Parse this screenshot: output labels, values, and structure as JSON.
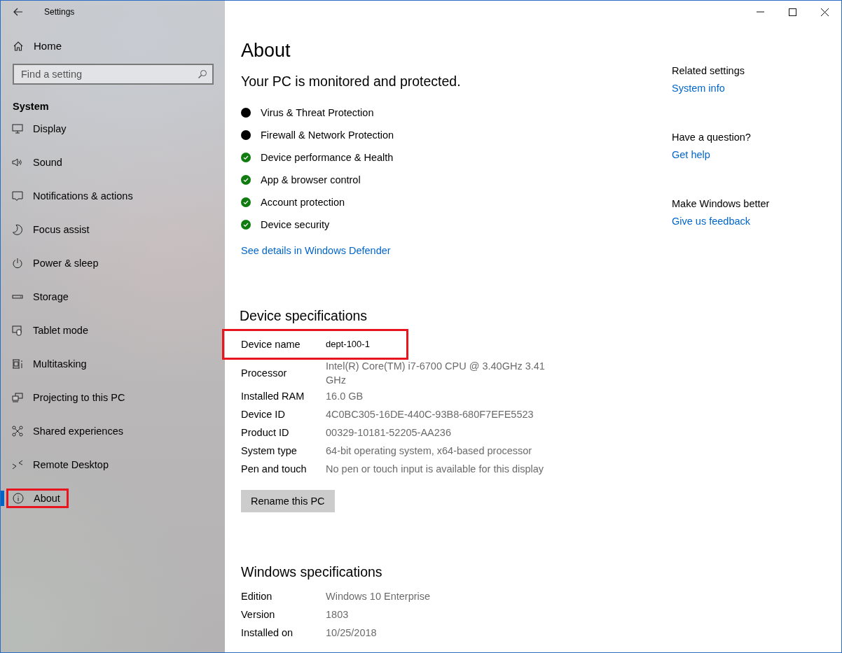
{
  "window": {
    "title": "Settings"
  },
  "sidebar": {
    "home": "Home",
    "search": {
      "placeholder": "Find a setting"
    },
    "section": "System",
    "items": [
      {
        "label": "Display",
        "selected": false,
        "highlighted": false
      },
      {
        "label": "Sound",
        "selected": false,
        "highlighted": false
      },
      {
        "label": "Notifications & actions",
        "selected": false,
        "highlighted": false
      },
      {
        "label": "Focus assist",
        "selected": false,
        "highlighted": false
      },
      {
        "label": "Power & sleep",
        "selected": false,
        "highlighted": false
      },
      {
        "label": "Storage",
        "selected": false,
        "highlighted": false
      },
      {
        "label": "Tablet mode",
        "selected": false,
        "highlighted": false
      },
      {
        "label": "Multitasking",
        "selected": false,
        "highlighted": false
      },
      {
        "label": "Projecting to this PC",
        "selected": false,
        "highlighted": false
      },
      {
        "label": "Shared experiences",
        "selected": false,
        "highlighted": false
      },
      {
        "label": "Remote Desktop",
        "selected": false,
        "highlighted": false
      },
      {
        "label": "About",
        "selected": true,
        "highlighted": true
      }
    ]
  },
  "main": {
    "title": "About",
    "security_heading": "Your PC is monitored and protected.",
    "security_items": [
      {
        "label": "Virus & Threat Protection",
        "kind": "dot"
      },
      {
        "label": "Firewall & Network Protection",
        "kind": "dot"
      },
      {
        "label": "Device performance & Health",
        "kind": "check"
      },
      {
        "label": "App & browser control",
        "kind": "check"
      },
      {
        "label": "Account protection",
        "kind": "check"
      },
      {
        "label": "Device security",
        "kind": "check"
      }
    ],
    "security_link": "See details in Windows Defender",
    "device_specs_heading": "Device specifications",
    "device_specs": [
      {
        "label": "Device name",
        "value": "dept-100-1",
        "highlighted": true
      },
      {
        "label": "Processor",
        "value": "Intel(R) Core(TM) i7-6700 CPU @ 3.40GHz   3.41 GHz",
        "highlighted": false
      },
      {
        "label": "Installed RAM",
        "value": "16.0 GB",
        "highlighted": false
      },
      {
        "label": "Device ID",
        "value": "4C0BC305-16DE-440C-93B8-680F7EFE5523",
        "highlighted": false
      },
      {
        "label": "Product ID",
        "value": "00329-10181-52205-AA236",
        "highlighted": false
      },
      {
        "label": "System type",
        "value": "64-bit operating system, x64-based processor",
        "highlighted": false
      },
      {
        "label": "Pen and touch",
        "value": "No pen or touch input is available for this display",
        "highlighted": false
      }
    ],
    "rename_button": "Rename this PC",
    "windows_specs_heading": "Windows specifications",
    "windows_specs": [
      {
        "label": "Edition",
        "value": "Windows 10 Enterprise"
      },
      {
        "label": "Version",
        "value": "1803"
      },
      {
        "label": "Installed on",
        "value": "10/25/2018"
      }
    ]
  },
  "related": [
    {
      "heading": "Related settings",
      "link": "System info"
    },
    {
      "heading": "Have a question?",
      "link": "Get help"
    },
    {
      "heading": "Make Windows better",
      "link": "Give us feedback"
    }
  ]
}
